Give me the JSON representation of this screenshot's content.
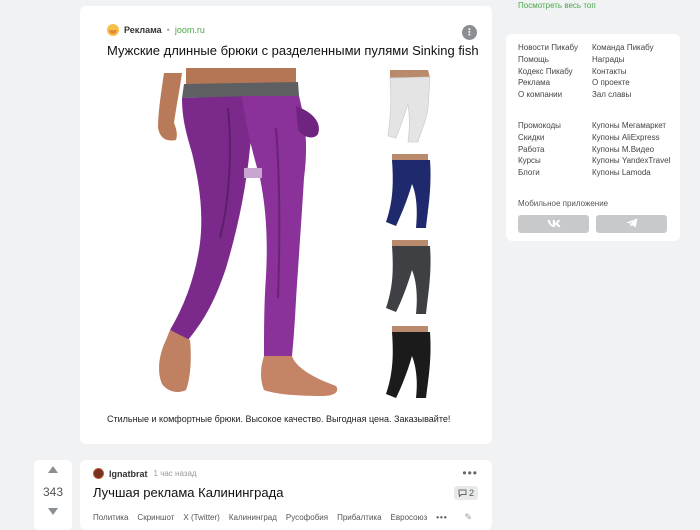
{
  "sidebar": {
    "see_all_top": "Посмотреть весь топ",
    "links_col1": [
      "Новости Пикабу",
      "Помощь",
      "Кодекс Пикабу",
      "Реклама",
      "О компании"
    ],
    "links_col2": [
      "Команда Пикабу",
      "Награды",
      "Контакты",
      "О проекте",
      "Зал славы"
    ],
    "links_col3": [
      "Промокоды",
      "Скидки",
      "Работа",
      "Курсы",
      "Блоги"
    ],
    "links_col4": [
      "Купоны Мегамаркет",
      "Купоны AliExpress",
      "Купоны М.Видео",
      "Купоны YandexTravel",
      "Купоны Lamoda"
    ],
    "mobile_app_label": "Мобильное приложение",
    "vk_label": "vk",
    "telegram_icon": "telegram-icon"
  },
  "ad": {
    "label": "Реклама",
    "separator": "•",
    "domain": "joom.ru",
    "title": "Мужские длинные брюки с разделенными пулями Sinking fish",
    "description": "Стильные и комфортные брюки. Высокое качество. Выгодная цена. Заказывайте!",
    "more_icon": "more-vertical-icon",
    "colors": {
      "main": "#7b2a8c",
      "variants": [
        "#e4e4e4",
        "#1f2a6e",
        "#3f4043",
        "#1b1b1b"
      ]
    }
  },
  "post": {
    "votes": "343",
    "author": "Ignatbrat",
    "time": "1 час назад",
    "title": "Лучшая реклама Калининграда",
    "comments": "2",
    "more_dots": "•••",
    "tags": [
      "Политика",
      "Скриншот",
      "X (Twitter)",
      "Калининград",
      "Русофобия",
      "Прибалтика",
      "Евросоюз"
    ],
    "tags_more": "•••"
  },
  "colors": {
    "accent_green": "#4ba74b",
    "background": "#f1f2f3"
  }
}
